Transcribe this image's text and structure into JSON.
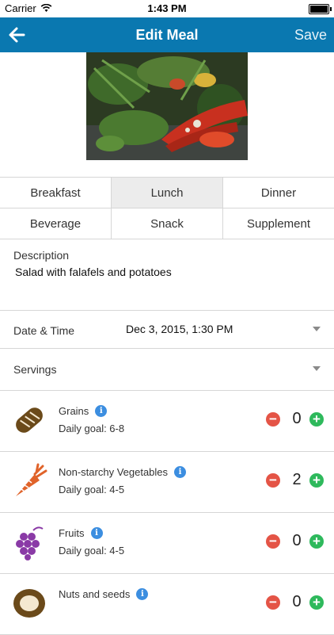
{
  "status": {
    "carrier": "Carrier",
    "time": "1:43 PM"
  },
  "nav": {
    "title": "Edit Meal",
    "save_label": "Save",
    "back_icon": "arrow-left-icon"
  },
  "meal_types": [
    [
      {
        "label": "Breakfast",
        "selected": false
      },
      {
        "label": "Lunch",
        "selected": true
      },
      {
        "label": "Dinner",
        "selected": false
      }
    ],
    [
      {
        "label": "Beverage",
        "selected": false
      },
      {
        "label": "Snack",
        "selected": false
      },
      {
        "label": "Supplement",
        "selected": false
      }
    ]
  ],
  "description": {
    "label": "Description",
    "value": "Salad with falafels and potatoes"
  },
  "datetime": {
    "label": "Date & Time",
    "value": "Dec 3, 2015, 1:30 PM"
  },
  "servings": {
    "label": "Servings"
  },
  "foods": [
    {
      "name": "Grains",
      "goal": "Daily goal: 6-8",
      "count": "0",
      "icon": "bread-icon",
      "color": "#6b4a1a"
    },
    {
      "name": "Non-starchy Vegetables",
      "goal": "Daily goal: 4-5",
      "count": "2",
      "icon": "carrot-icon",
      "color": "#e0632a"
    },
    {
      "name": "Fruits",
      "goal": "Daily goal: 4-5",
      "count": "0",
      "icon": "grapes-icon",
      "color": "#8a3aa6"
    },
    {
      "name": "Nuts and seeds",
      "goal": "",
      "count": "0",
      "icon": "nut-icon",
      "color": "#6b4a1a"
    }
  ],
  "colors": {
    "nav_bar": "#0a78b0",
    "minus": "#e45446",
    "plus": "#2eb95c",
    "info": "#3c8ee0"
  }
}
